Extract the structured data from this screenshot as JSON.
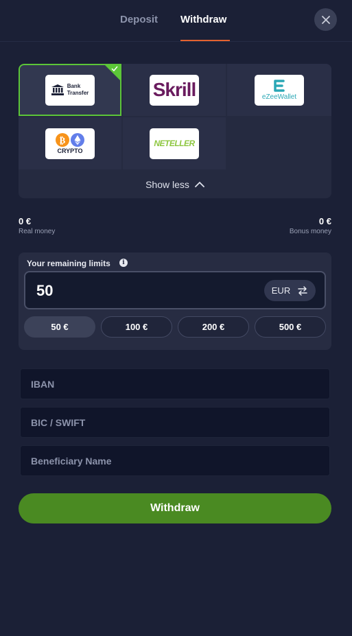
{
  "tabs": {
    "deposit": "Deposit",
    "withdraw": "Withdraw"
  },
  "methods": {
    "bank": {
      "line1": "Bank",
      "line2": "Transfer",
      "selected": true
    },
    "skrill": "Skrill",
    "ezee": "eZeeWallet",
    "crypto": "CRYPTO",
    "neteller": "NETELLER"
  },
  "show_less": "Show less",
  "balance": {
    "real_amount": "0 €",
    "real_label": "Real money",
    "bonus_amount": "0 €",
    "bonus_label": "Bonus money"
  },
  "limits": {
    "title": "Your remaining limits",
    "info_glyph": "i",
    "amount": "50",
    "currency": "EUR",
    "quick_amounts": [
      "50 €",
      "100 €",
      "200 €",
      "500 €"
    ]
  },
  "form": {
    "iban_placeholder": "IBAN",
    "bic_placeholder": "BIC / SWIFT",
    "beneficiary_placeholder": "Beneficiary Name"
  },
  "submit_label": "Withdraw",
  "colors": {
    "background": "#1b2036",
    "accent_orange": "#e4622f",
    "selected_green": "#5cc638",
    "button_green": "#4a8a22"
  },
  "icons": [
    "close-icon",
    "bank-icon",
    "chevron-up-icon",
    "info-icon",
    "swap-icon",
    "bitcoin-icon",
    "ethereum-icon"
  ]
}
